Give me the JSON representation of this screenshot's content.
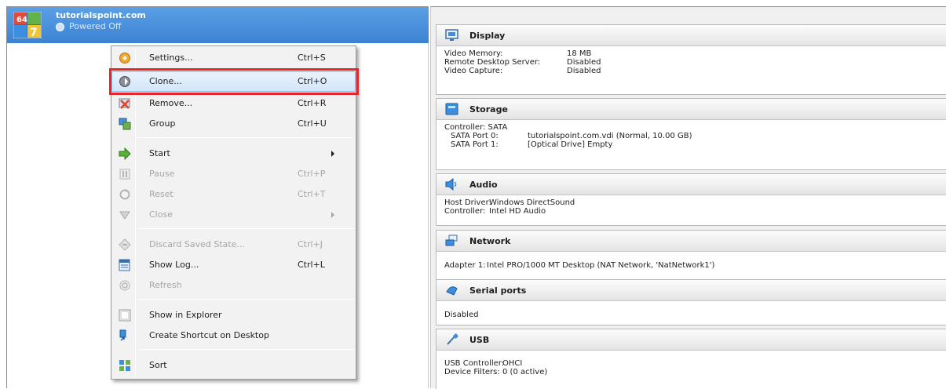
{
  "vm": {
    "name": "tutorialspoint.com",
    "state": "Powered Off",
    "logo_badge": "64",
    "logo_version": "7"
  },
  "context_menu": {
    "items": [
      {
        "label": "Settings...",
        "shortcut": "Ctrl+S",
        "icon": "gear-icon",
        "enabled": true
      },
      {
        "label": "Clone...",
        "shortcut": "Ctrl+O",
        "icon": "clone-icon",
        "enabled": true,
        "highlighted": true
      },
      {
        "label": "Remove...",
        "shortcut": "Ctrl+R",
        "icon": "remove-icon",
        "enabled": true
      },
      {
        "label": "Group",
        "shortcut": "Ctrl+U",
        "icon": "group-icon",
        "enabled": true
      },
      {
        "label": "Start",
        "shortcut": "",
        "icon": "start-arrow-icon",
        "enabled": true,
        "submenu": true
      },
      {
        "label": "Pause",
        "shortcut": "Ctrl+P",
        "icon": "pause-icon",
        "enabled": false
      },
      {
        "label": "Reset",
        "shortcut": "Ctrl+T",
        "icon": "reset-icon",
        "enabled": false
      },
      {
        "label": "Close",
        "shortcut": "",
        "icon": "close-down-icon",
        "enabled": false,
        "submenu": true
      },
      {
        "label": "Discard Saved State...",
        "shortcut": "Ctrl+J",
        "icon": "discard-icon",
        "enabled": false
      },
      {
        "label": "Show Log...",
        "shortcut": "Ctrl+L",
        "icon": "log-icon",
        "enabled": true
      },
      {
        "label": "Refresh",
        "shortcut": "",
        "icon": "refresh-icon",
        "enabled": false
      },
      {
        "label": "Show in Explorer",
        "shortcut": "",
        "icon": "explorer-icon",
        "enabled": true
      },
      {
        "label": "Create Shortcut on Desktop",
        "shortcut": "",
        "icon": "shortcut-icon",
        "enabled": true
      },
      {
        "label": "Sort",
        "shortcut": "",
        "icon": "sort-icon",
        "enabled": true
      }
    ]
  },
  "details": {
    "display": {
      "title": "Display",
      "rows": [
        {
          "key": "Video Memory:",
          "value": "18 MB"
        },
        {
          "key": "Remote Desktop Server:",
          "value": "Disabled"
        },
        {
          "key": "Video Capture:",
          "value": "Disabled"
        }
      ]
    },
    "storage": {
      "title": "Storage",
      "controller": "Controller: SATA",
      "rows": [
        {
          "key": "SATA Port 0:",
          "value": "tutorialspoint.com.vdi (Normal, 10.00 GB)"
        },
        {
          "key": "SATA Port 1:",
          "value": "[Optical Drive] Empty"
        }
      ]
    },
    "audio": {
      "title": "Audio",
      "rows": [
        {
          "key": "Host Driver:",
          "value": "Windows DirectSound"
        },
        {
          "key": "Controller:",
          "value": "Intel HD Audio"
        }
      ]
    },
    "network": {
      "title": "Network",
      "rows": [
        {
          "key": "Adapter 1:",
          "value": "Intel PRO/1000 MT Desktop (NAT Network, 'NatNetwork1')"
        }
      ]
    },
    "serial": {
      "title": "Serial ports",
      "value": "Disabled"
    },
    "usb": {
      "title": "USB",
      "rows": [
        {
          "key": "USB Controller:",
          "value": "OHCI"
        },
        {
          "key": "Device Filters:",
          "value": "0 (0 active)"
        }
      ]
    }
  },
  "colors": {
    "selection": "#4a91dc",
    "highlight_box": "#e8262a",
    "menu_bg": "#f2f2f2",
    "panel_bg": "#f0f0f0"
  }
}
